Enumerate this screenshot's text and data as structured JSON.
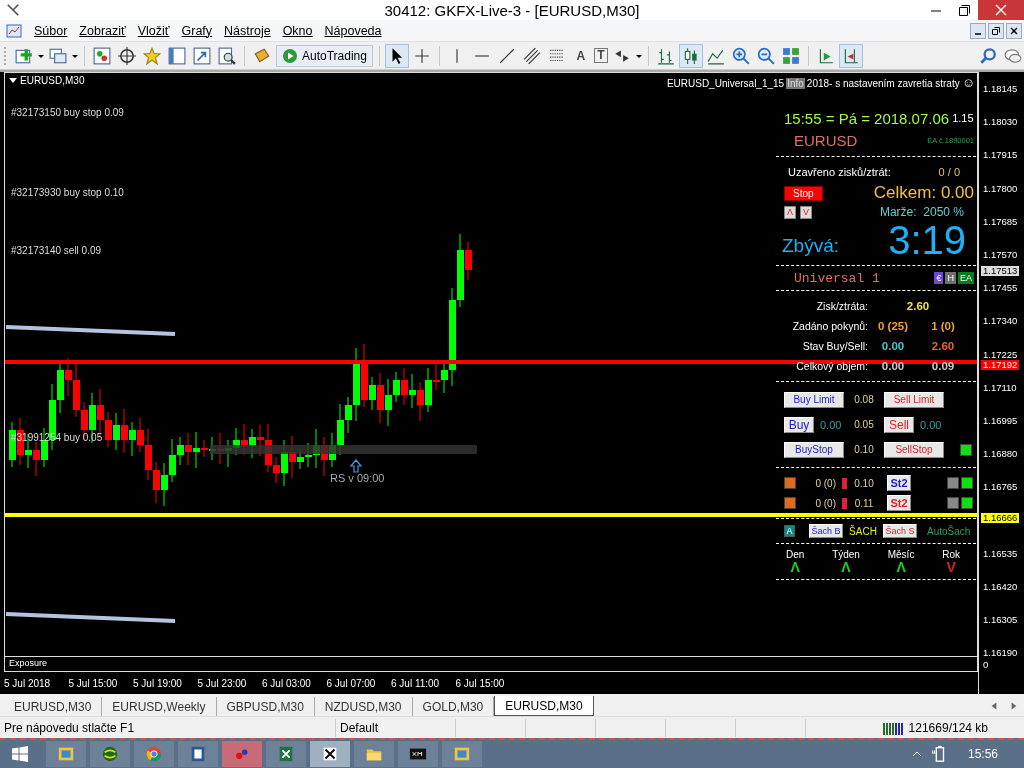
{
  "window": {
    "title": "30412: GKFX-Live-3 - [EURUSD,M30]"
  },
  "menu": [
    "Súbor",
    "Zobraziť",
    "Vložiť",
    "Grafy",
    "Nástroje",
    "Okno",
    "Nápoveda"
  ],
  "toolbar": {
    "autotrading": "AutoTrading",
    "text_tool": "A",
    "label_tool": "T"
  },
  "chart": {
    "symbol": "EURUSD,M30",
    "orders": [
      "#32173150 buy stop 0.09",
      "#32173930 buy stop 0.10",
      "#32173140 sell 0.09",
      "#31991254 buy 0.05"
    ],
    "marker": "RS v 09:00",
    "lines": [
      {
        "price": "1.17192",
        "color": "#ff0000"
      },
      {
        "price": "1.16666",
        "color": "#ffff00"
      }
    ],
    "bid": "1.17513",
    "price_ticks": [
      "1.18145",
      "1.18030",
      "1.17915",
      "1.17800",
      "1.17685",
      "1.17570",
      "1.17455",
      "1.17340",
      "1.17225",
      "1.17110",
      "1.16995",
      "1.16880",
      "1.16765",
      "1.16535",
      "1.16420",
      "1.16305",
      "1.16190"
    ],
    "time_ticks": [
      "5 Jul 2018",
      "5 Jul 15:00",
      "5 Jul 19:00",
      "5 Jul 23:00",
      "6 Jul 03:00",
      "6 Jul 07:00",
      "6 Jul 11:00",
      "6 Jul 15:00"
    ],
    "subwindow": {
      "title": "Exposure",
      "scale": "0"
    }
  },
  "panel": {
    "header": {
      "name": "EURUSD_Universal_1_15",
      "badge": "Info",
      "note": "2018- s nastavením zavretia straty",
      "smiley": "☺"
    },
    "datetime": "15:55 = Pá = 2018.07.06",
    "spread": "1.15",
    "symbol": "EURUSD",
    "ea_id": "EA č.1890001",
    "closed_label": "Uzavřeno zisků/ztrát:",
    "closed_value": "0 / 0",
    "stop_button": "Stop",
    "total": "Celkem: 0.00",
    "up_button": "Λ",
    "down_button": "V",
    "margin": "Marže:  2050 %",
    "remaining_label": "Zbývá:",
    "remaining_time": "3:19",
    "strategy": "Universal 1",
    "badges": [
      {
        "text": "€",
        "color": "#6a48d8"
      },
      {
        "text": "H",
        "color": "#707070"
      },
      {
        "text": "EA",
        "color": "#0a7a1a"
      }
    ],
    "stats": [
      {
        "label": "Zisk/ztráta:",
        "values": [
          {
            "text": "2.60",
            "color": "#f0e040"
          }
        ]
      },
      {
        "label": "Zadáno pokynů:",
        "values": [
          {
            "text": "0 (25)",
            "color": "#f0a030"
          },
          {
            "text": "1 (0)",
            "color": "#f0a030"
          }
        ]
      },
      {
        "label": "Stav Buy/Sell:",
        "values": [
          {
            "text": "0.00",
            "color": "#40c8c8"
          },
          {
            "text": "2.60",
            "color": "#f06030"
          }
        ]
      },
      {
        "label": "Celkový objem:",
        "values": [
          {
            "text": "0.00",
            "color": "#c8c8c8"
          },
          {
            "text": "0.09",
            "color": "#c8c8c8"
          }
        ]
      }
    ],
    "orders": {
      "buy_limit": "Buy Limit",
      "limit_lots": "0.08",
      "sell_limit": "Sell Limit",
      "buy": "Buy",
      "buy_value": "0.00",
      "market_lots": "0.05",
      "sell": "Sell",
      "sell_value": "0.00",
      "buy_stop": "BuyStop",
      "stop_lots": "0.10",
      "sell_stop": "SellStop"
    },
    "st_rows": [
      {
        "count": "0 (0)",
        "lots": "0.10",
        "button": "St2",
        "color": "#1a1ad0"
      },
      {
        "count": "0 (0)",
        "lots": "0.11",
        "button": "St2",
        "color": "#e02020"
      }
    ],
    "chess": {
      "auto_button": "A",
      "buy_button": "Šach B",
      "label": "ŠACH",
      "sell_button": "Šach S",
      "auto_label": "AutoŠach"
    },
    "trends": [
      {
        "period": "Den",
        "symbol": "Λ",
        "color": "#20d020"
      },
      {
        "period": "Týden",
        "symbol": "Λ",
        "color": "#20d020"
      },
      {
        "period": "Měsíc",
        "symbol": "Λ",
        "color": "#20d020"
      },
      {
        "period": "Rok",
        "symbol": "V",
        "color": "#e02020"
      }
    ]
  },
  "tabs": [
    {
      "label": "EURUSD,M30",
      "selected": false
    },
    {
      "label": "EURUSD,Weekly",
      "selected": false
    },
    {
      "label": "GBPUSD,M30",
      "selected": false
    },
    {
      "label": "NZDUSD,M30",
      "selected": false
    },
    {
      "label": "GOLD,M30",
      "selected": false
    },
    {
      "label": "EURUSD,M30",
      "selected": true
    }
  ],
  "status_bar": {
    "help": "Pre nápovedu stlačte F1",
    "profile": "Default",
    "traffic": "121669/124 kb"
  },
  "taskbar": {
    "clock": "15:56"
  }
}
